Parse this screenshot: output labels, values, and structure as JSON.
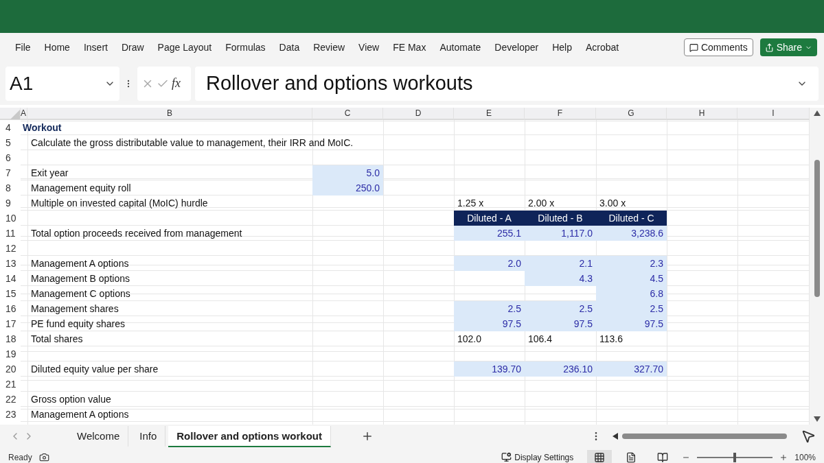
{
  "menu": [
    {
      "label": "File"
    },
    {
      "label": "Home"
    },
    {
      "label": "Insert"
    },
    {
      "label": "Draw"
    },
    {
      "label": "Page Layout"
    },
    {
      "label": "Formulas"
    },
    {
      "label": "Data"
    },
    {
      "label": "Review"
    },
    {
      "label": "View"
    },
    {
      "label": "FE Max"
    },
    {
      "label": "Automate"
    },
    {
      "label": "Developer"
    },
    {
      "label": "Help"
    },
    {
      "label": "Acrobat"
    }
  ],
  "actions": {
    "comments": "Comments",
    "share": "Share"
  },
  "formula_bar": {
    "name_box": "A1",
    "fx": "fx",
    "formula": "Rollover and options workouts"
  },
  "columns": [
    "A",
    "B",
    "C",
    "D",
    "E",
    "F",
    "G",
    "H",
    "I"
  ],
  "rows": [
    {
      "number": "4",
      "cells": {
        "a": {
          "text": "Workout",
          "kind": "title"
        }
      }
    },
    {
      "number": "5",
      "cells": {
        "b": {
          "text": "Calculate the gross distributable value to management, their IRR and MoIC.",
          "kind": "plain"
        }
      }
    },
    {
      "number": "6",
      "cells": {}
    },
    {
      "number": "7",
      "cells": {
        "b": {
          "text": "Exit year",
          "kind": "plain"
        },
        "c": {
          "text": "5.0",
          "kind": "input"
        }
      }
    },
    {
      "number": "8",
      "cells": {
        "b": {
          "text": "Management equity roll",
          "kind": "plain"
        },
        "c": {
          "text": "250.0",
          "kind": "input"
        }
      }
    },
    {
      "number": "9",
      "cells": {
        "b": {
          "text": "Multiple on invested capital (MoIC) hurdle",
          "kind": "plain"
        },
        "e": {
          "text": "1.25 x",
          "kind": "plain"
        },
        "f": {
          "text": "2.00 x",
          "kind": "plain"
        },
        "g": {
          "text": "3.00 x",
          "kind": "plain"
        }
      }
    },
    {
      "number": "10",
      "cells": {
        "e": {
          "text": "Diluted - A",
          "kind": "header"
        },
        "f": {
          "text": "Diluted - B",
          "kind": "header"
        },
        "g": {
          "text": "Diluted - C",
          "kind": "header"
        }
      }
    },
    {
      "number": "11",
      "cells": {
        "b": {
          "text": "Total option proceeds received from management",
          "kind": "plain"
        },
        "e": {
          "text": "255.1",
          "kind": "input"
        },
        "f": {
          "text": "1,117.0",
          "kind": "input"
        },
        "g": {
          "text": "3,238.6",
          "kind": "input"
        }
      }
    },
    {
      "number": "12",
      "cells": {}
    },
    {
      "number": "13",
      "cells": {
        "b": {
          "text": "Management A options",
          "kind": "plain"
        },
        "e": {
          "text": "2.0",
          "kind": "input"
        },
        "f": {
          "text": "2.1",
          "kind": "input"
        },
        "g": {
          "text": "2.3",
          "kind": "input"
        }
      }
    },
    {
      "number": "14",
      "cells": {
        "b": {
          "text": "Management B options",
          "kind": "plain"
        },
        "f": {
          "text": "4.3",
          "kind": "input"
        },
        "g": {
          "text": "4.5",
          "kind": "input"
        }
      }
    },
    {
      "number": "15",
      "cells": {
        "b": {
          "text": "Management C options",
          "kind": "plain"
        },
        "g": {
          "text": "6.8",
          "kind": "input"
        }
      }
    },
    {
      "number": "16",
      "cells": {
        "b": {
          "text": "Management shares",
          "kind": "plain"
        },
        "e": {
          "text": "2.5",
          "kind": "input"
        },
        "f": {
          "text": "2.5",
          "kind": "input"
        },
        "g": {
          "text": "2.5",
          "kind": "input"
        }
      }
    },
    {
      "number": "17",
      "cells": {
        "b": {
          "text": "PE fund equity shares",
          "kind": "plain"
        },
        "e": {
          "text": "97.5",
          "kind": "input"
        },
        "f": {
          "text": "97.5",
          "kind": "input"
        },
        "g": {
          "text": "97.5",
          "kind": "input"
        }
      }
    },
    {
      "number": "18",
      "cells": {
        "b": {
          "text": "Total shares",
          "kind": "plain"
        },
        "e": {
          "text": "102.0",
          "kind": "plain"
        },
        "f": {
          "text": "106.4",
          "kind": "plain"
        },
        "g": {
          "text": "113.6",
          "kind": "plain"
        }
      }
    },
    {
      "number": "19",
      "cells": {}
    },
    {
      "number": "20",
      "cells": {
        "b": {
          "text": "Diluted equity value per share",
          "kind": "plain"
        },
        "e": {
          "text": "139.70",
          "kind": "input"
        },
        "f": {
          "text": "236.10",
          "kind": "input"
        },
        "g": {
          "text": "327.70",
          "kind": "input"
        }
      }
    },
    {
      "number": "21",
      "cells": {}
    },
    {
      "number": "22",
      "cells": {
        "b": {
          "text": "Gross option value",
          "kind": "plain"
        }
      }
    },
    {
      "number": "23",
      "cells": {
        "b": {
          "text": "Management A options",
          "kind": "plain"
        }
      }
    }
  ],
  "sheet_tabs": [
    {
      "label": "Welcome",
      "selected": false
    },
    {
      "label": "Info",
      "selected": false
    },
    {
      "label": "Rollover and options workout",
      "selected": true
    }
  ],
  "status_bar": {
    "mode": "Ready",
    "display_settings": "Display Settings",
    "zoom": "100%",
    "zoom_slider": {
      "level": 0.5
    }
  }
}
